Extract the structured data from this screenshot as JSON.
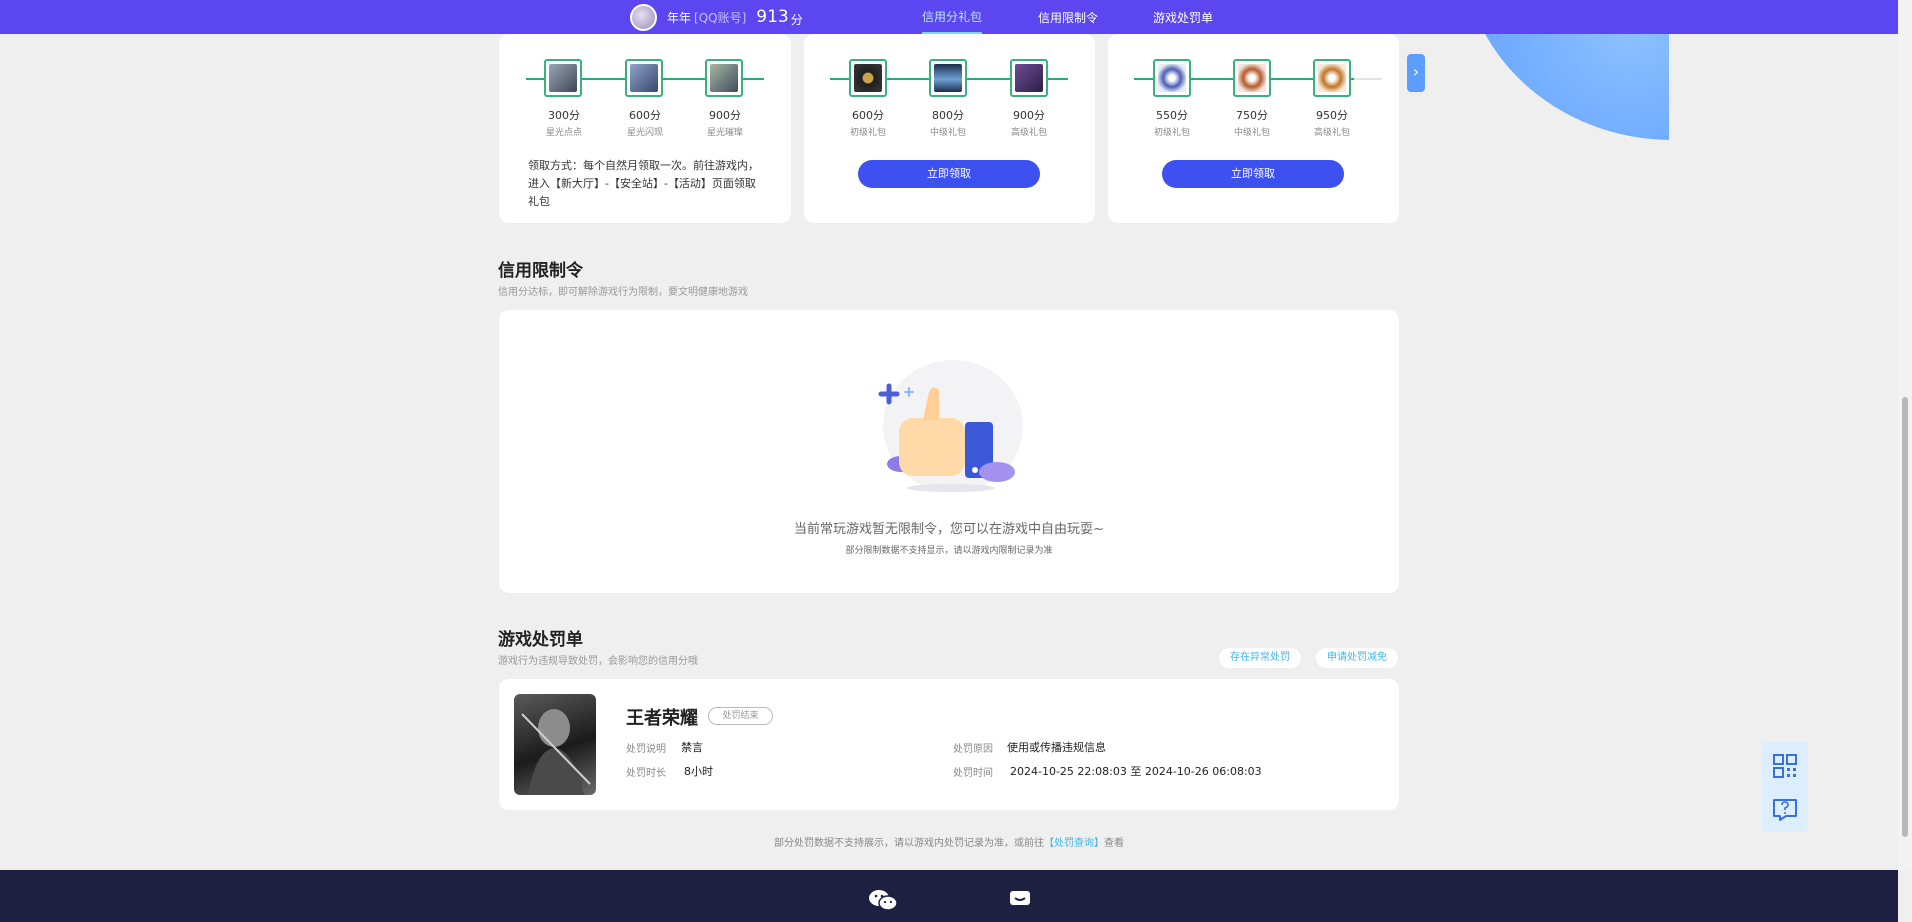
{
  "header": {
    "user_name": "年年",
    "account_type": "[QQ账号]",
    "score": "913",
    "score_unit": "分",
    "nav": [
      {
        "label": "信用分礼包",
        "active": true
      },
      {
        "label": "信用限制令",
        "active": false
      },
      {
        "label": "游戏处罚单",
        "active": false
      }
    ]
  },
  "gift_cards": [
    {
      "gifts": [
        {
          "score": "300分",
          "name": "星光点点"
        },
        {
          "score": "600分",
          "name": "星光闪现"
        },
        {
          "score": "900分",
          "name": "星光璀璨"
        }
      ],
      "method": "领取方式：每个自然月领取一次。前往游戏内，进入【新大厅】-【安全站】-【活动】页面领取礼包"
    },
    {
      "gifts": [
        {
          "score": "600分",
          "name": "初级礼包"
        },
        {
          "score": "800分",
          "name": "中级礼包"
        },
        {
          "score": "900分",
          "name": "高级礼包"
        }
      ],
      "button": "立即领取"
    },
    {
      "gifts": [
        {
          "score": "550分",
          "name": "初级礼包"
        },
        {
          "score": "750分",
          "name": "中级礼包"
        },
        {
          "score": "950分",
          "name": "高级礼包"
        }
      ],
      "button": "立即领取"
    }
  ],
  "restriction": {
    "title": "信用限制令",
    "subtitle": "信用分达标，即可解除游戏行为限制，要文明健康地游戏",
    "empty_main": "当前常玩游戏暂无限制令，您可以在游戏中自由玩耍~",
    "empty_sub": "部分限制数据不支持显示，请以游戏内限制记录为准"
  },
  "punishment": {
    "title": "游戏处罚单",
    "subtitle": "游戏行为违规导致处罚，会影响您的信用分哦",
    "pill_1": "存在异常处罚",
    "pill_2": "申请处罚减免",
    "game": "王者荣耀",
    "status": "处罚结束",
    "desc_label": "处罚说明",
    "desc_value": "禁言",
    "duration_label": "处罚时长",
    "duration_value": "8小时",
    "reason_label": "处罚原因",
    "reason_value": "使用或传播违规信息",
    "time_label": "处罚时间",
    "time_value": "2024-10-25 22:08:03 至 2024-10-26 06:08:03"
  },
  "footnote": {
    "text": "部分处罚数据不支持展示，请以游戏内处罚记录为准，或前往",
    "link": "【处罚查询】",
    "suffix": "查看"
  }
}
